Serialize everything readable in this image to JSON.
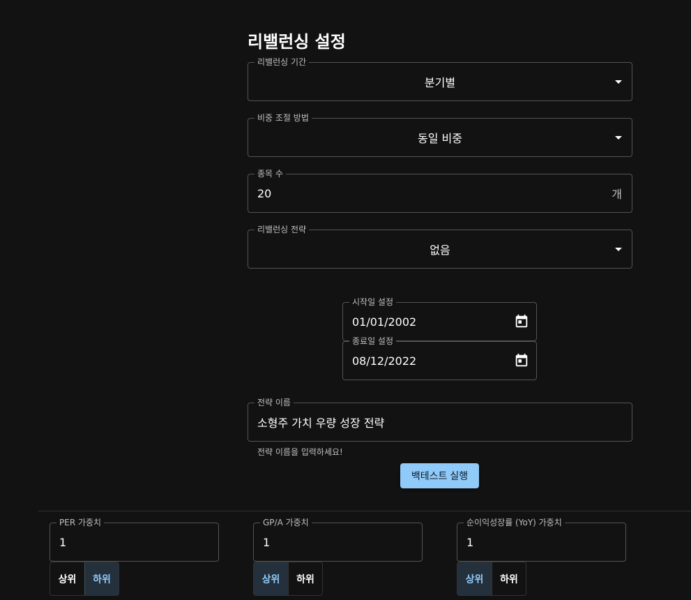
{
  "page_title": "리밸런싱 설정",
  "rebalancing_period": {
    "label": "리밸런싱 기간",
    "value": "분기별"
  },
  "weight_method": {
    "label": "비중 조절 방법",
    "value": "동일 비중"
  },
  "stock_count": {
    "label": "종목 수",
    "value": "20",
    "unit": "개"
  },
  "rebalancing_strategy": {
    "label": "리밸런싱 전략",
    "value": "없음"
  },
  "start_date": {
    "label": "시작일 설정",
    "value": "01/01/2002",
    "icon": "calendar-icon"
  },
  "end_date": {
    "label": "종료일 설정",
    "value": "08/12/2022",
    "icon": "calendar-icon"
  },
  "strategy_name": {
    "label": "전략 이름",
    "value": "소형주 가치 우량 성장 전략",
    "helper": "전략 이름을 입력하세요!"
  },
  "run_button": {
    "label": "백테스트 실행"
  },
  "factors": [
    {
      "label": "PER 가중치",
      "value": "1",
      "top_label": "상위",
      "bottom_label": "하위",
      "selected": "하위"
    },
    {
      "label": "GP/A 가중치",
      "value": "1",
      "top_label": "상위",
      "bottom_label": "하위",
      "selected": "상위"
    },
    {
      "label": "순이익성장률 (YoY) 가중치",
      "value": "1",
      "top_label": "상위",
      "bottom_label": "하위",
      "selected": "상위"
    }
  ],
  "colors": {
    "background": "#121212",
    "accent": "#90caf9",
    "selected_toggle_bg": "#24303c"
  }
}
